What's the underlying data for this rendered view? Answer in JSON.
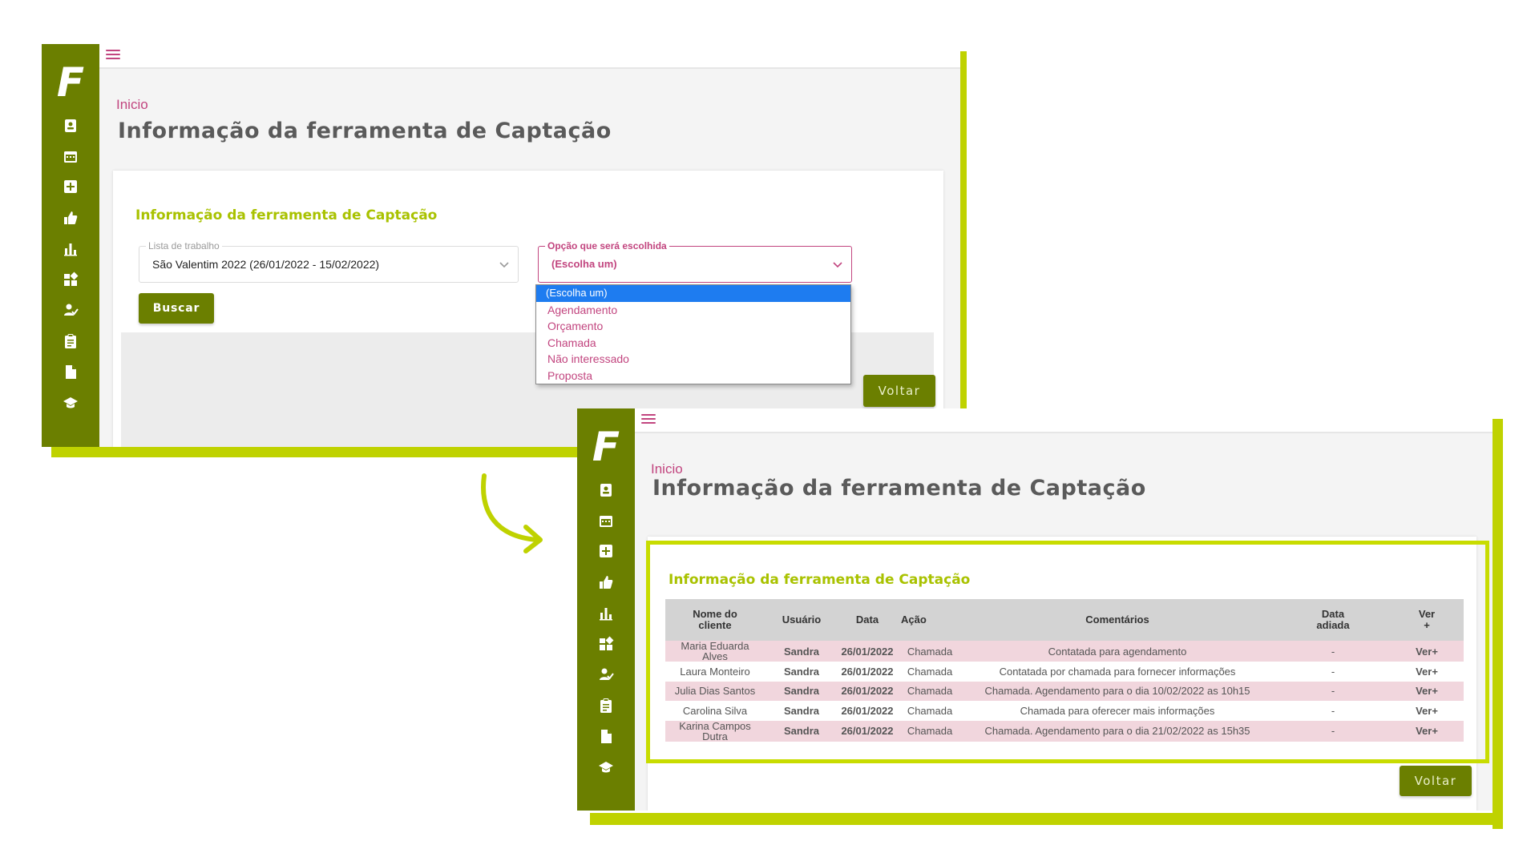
{
  "colors": {
    "sidebar": "#6b7f00",
    "accent_lime": "#bfd200",
    "pink": "#c2457f",
    "card_title": "#a9c200",
    "button": "#6b7f00",
    "dropdown_selected": "#1e7cf0",
    "row_highlight": "#f1d6dd"
  },
  "sidebar": {
    "logo": "F",
    "icons": [
      "contact-badge-icon",
      "calendar-icon",
      "add-box-icon",
      "thumbs-up-icon",
      "bar-chart-icon",
      "dashboard-icon",
      "user-check-icon",
      "clipboard-icon",
      "document-icon",
      "graduation-cap-icon"
    ]
  },
  "screen1": {
    "breadcrumb": "Inicio",
    "title": "Informação da ferramenta de Captação",
    "card_title": "Informação da ferramenta de Captação",
    "work_list": {
      "legend": "Lista de trabalho",
      "value": "São Valentim 2022 (26/01/2022 - 15/02/2022)"
    },
    "option_select": {
      "legend": "Opção que será escolhida",
      "value": "(Escolha um)",
      "options": [
        "(Escolha um)",
        "Agendamento",
        "Orçamento",
        "Chamada",
        "Não interessado",
        "Proposta"
      ]
    },
    "search_button": "Buscar",
    "back_button": "Voltar"
  },
  "screen2": {
    "breadcrumb": "Inicio",
    "title": "Informação da ferramenta de Captação",
    "card_title": "Informação da ferramenta de Captação",
    "table": {
      "headers": {
        "name": [
          "Nome do",
          "cliente"
        ],
        "user": "Usuário",
        "date": "Data",
        "action": "Ação",
        "comment": "Comentários",
        "postponed": [
          "Data",
          "adiada"
        ],
        "view": [
          "Ver",
          "+"
        ]
      },
      "rows": [
        {
          "name": [
            "Maria Eduarda",
            "Alves"
          ],
          "user": "Sandra",
          "date": "26/01/2022",
          "action": "Chamada",
          "comment": "Contatada para agendamento",
          "postponed": "-",
          "view": "Ver+"
        },
        {
          "name": [
            "Laura Monteiro"
          ],
          "user": "Sandra",
          "date": "26/01/2022",
          "action": "Chamada",
          "comment": "Contatada por chamada para fornecer informações",
          "postponed": "-",
          "view": "Ver+"
        },
        {
          "name": [
            "Julia Dias Santos"
          ],
          "user": "Sandra",
          "date": "26/01/2022",
          "action": "Chamada",
          "comment": "Chamada. Agendamento para o dia 10/02/2022 as 10h15",
          "postponed": "-",
          "view": "Ver+"
        },
        {
          "name": [
            "Carolina Silva"
          ],
          "user": "Sandra",
          "date": "26/01/2022",
          "action": "Chamada",
          "comment": "Chamada para oferecer mais informações",
          "postponed": "-",
          "view": "Ver+"
        },
        {
          "name": [
            "Karina Campos",
            "Dutra"
          ],
          "user": "Sandra",
          "date": "26/01/2022",
          "action": "Chamada",
          "comment": "Chamada. Agendamento para o dia 21/02/2022 as 15h35",
          "postponed": "-",
          "view": "Ver+"
        }
      ]
    },
    "back_button": "Voltar"
  }
}
